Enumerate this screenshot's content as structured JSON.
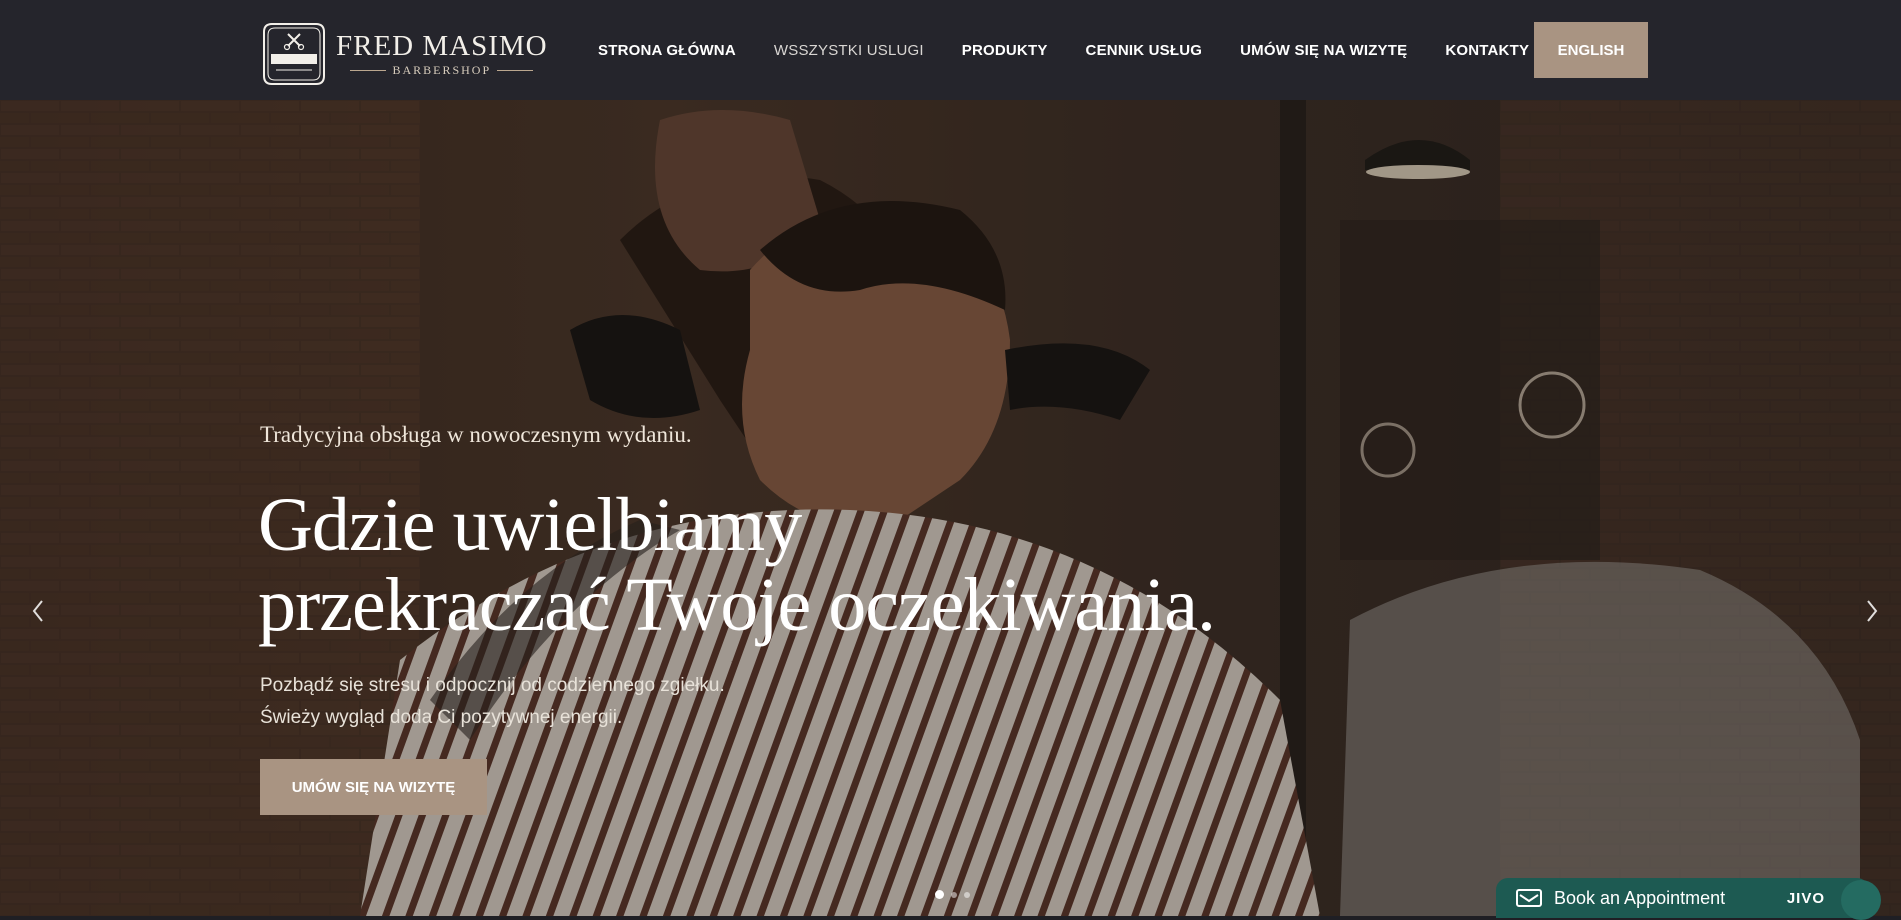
{
  "header": {
    "logo": {
      "name": "FRED MASIMO",
      "sub": "BARBERSHOP",
      "badge_top": "HAIRCUT & SHAVE",
      "badge_mid": "BARBERSHOP",
      "badge_bottom": "PREMIUM"
    },
    "nav": [
      {
        "label": "STRONA GŁÓWNA"
      },
      {
        "label": "WSSZYSTKI USLUGI"
      },
      {
        "label": "PRODUKTY"
      },
      {
        "label": "CENNIK USŁUG"
      },
      {
        "label": "UMÓW SIĘ NA WIZYTĘ"
      },
      {
        "label": "KONTAKTY"
      }
    ],
    "language_button": "ENGLISH"
  },
  "hero": {
    "tagline": "Tradycyjna obsługa w nowoczesnym wydaniu.",
    "headline_line1": "Gdzie uwielbiamy",
    "headline_line2": "przekraczać Twoje oczekiwania.",
    "desc_line1": "Pozbądź się stresu i odpocznij od codziennego zgiełku.",
    "desc_line2": "Świeży wygląd doda Ci pozytywnej energii.",
    "cta_label": "UMÓW SIĘ NA WIZYTĘ",
    "slides_total": 3,
    "slide_active": 1
  },
  "chat_widget": {
    "label": "Book an Appointment",
    "brand": "JIVO"
  },
  "colors": {
    "header_bg": "#25252c",
    "accent": "#a99482",
    "chat_bg": "#1d5a52"
  },
  "icons": [
    "chevron-left-icon",
    "chevron-right-icon",
    "envelope-icon",
    "scissors-icon"
  ]
}
